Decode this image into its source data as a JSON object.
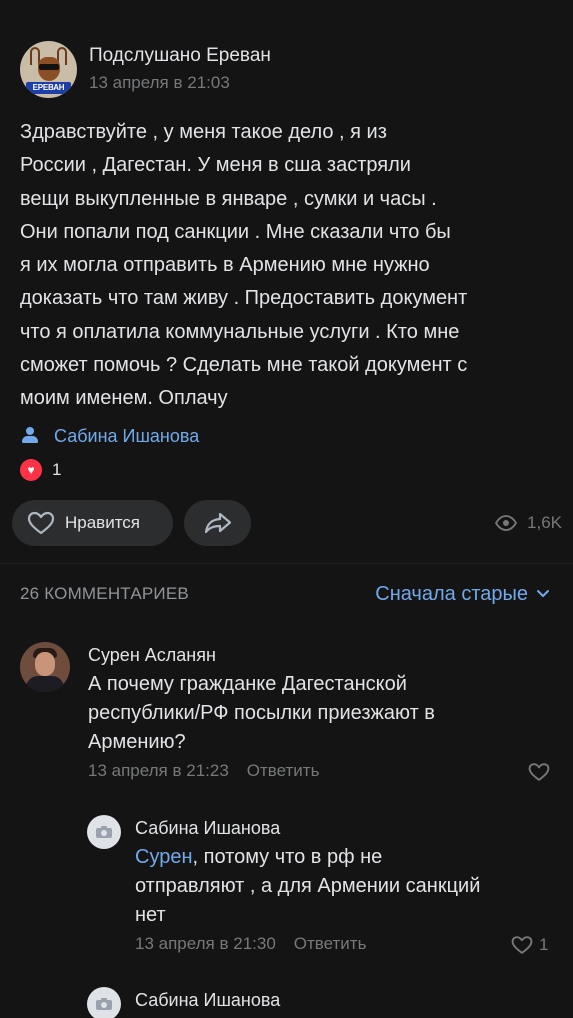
{
  "post": {
    "group_name": "Подслушано Ереван",
    "date": "13 апреля в 21:03",
    "avatar_badge": "ЕРЕВАН",
    "text_lines": [
      "Здравствуйте , у меня такое дело , я из",
      "России , Дагестан. У меня в сша застряли",
      "вещи выкупленные в январе , сумки и часы .",
      "Они попали под санкции . Мне сказали что бы",
      "я их могла отправить в Армению мне нужно",
      "доказать что там живу . Предоставить документ",
      "что я оплатила коммунальные услуги . Кто мне",
      "сможет помочь ? Сделать мне такой документ с",
      "моим именем. Оплачу"
    ],
    "author": "Сабина Ишанова",
    "reactions_count": "1",
    "like_label": "Нравится",
    "views": "1,6K"
  },
  "comments_bar": {
    "count_label": "26 КОММЕНТАРИЕВ",
    "sort_label": "Сначала старые"
  },
  "comments": [
    {
      "name": "Сурен Асланян",
      "text_lines": [
        "А почему гражданке Дагестанской",
        "республики/РФ посылки приезжают в",
        "Армению?"
      ],
      "date": "13 апреля в 21:23",
      "reply_label": "Ответить"
    }
  ],
  "replies": [
    {
      "name": "Сабина Ишанова",
      "mention": "Сурен",
      "text_first": ", потому что в рф не",
      "text_lines": [
        "отправляют , а для Армении санкций",
        "нет"
      ],
      "date": "13 апреля в 21:30",
      "reply_label": "Ответить",
      "likes": "1"
    },
    {
      "name": "Сабина Ишанова"
    }
  ],
  "colors": {
    "background": "#141414",
    "accent": "#71aaeb",
    "secondary_text": "#76787a",
    "heart": "#ff3347"
  }
}
